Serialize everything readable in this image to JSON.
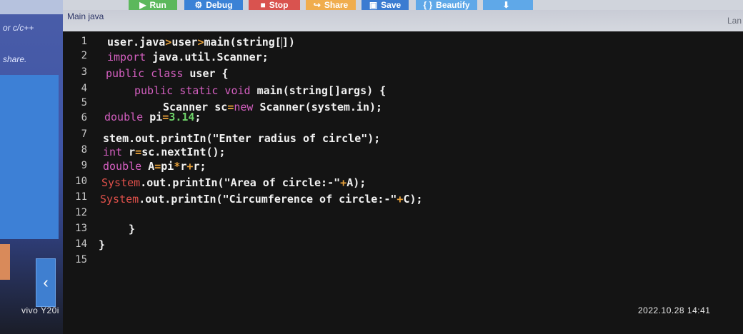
{
  "sidebar": {
    "items": [
      "or c/c++",
      "share."
    ],
    "back_icon": "chevron-left-icon"
  },
  "toolbar": {
    "buttons": [
      {
        "label": "Run",
        "icon": "play-icon",
        "color": "#5cb85c"
      },
      {
        "label": "Debug",
        "icon": "bug-icon",
        "color": "#3b82d6"
      },
      {
        "label": "Stop",
        "icon": "stop-icon",
        "color": "#d9534f"
      },
      {
        "label": "Share",
        "icon": "share-icon",
        "color": "#f0ad4e"
      },
      {
        "label": "Save",
        "icon": "save-icon",
        "color": "#3b7bd1"
      },
      {
        "label": "Beautify",
        "icon": "braces-icon",
        "color": "#5fa8e8"
      },
      {
        "label": "",
        "icon": "download-icon",
        "color": "#5fa8e8"
      }
    ]
  },
  "tab": {
    "label": "Main java"
  },
  "lang_label": "Lan",
  "editor": {
    "line_numbers": [
      "1",
      "2",
      "3",
      "4",
      "5",
      "6",
      "7",
      "8",
      "9",
      "10",
      "11",
      "12",
      "13",
      "14",
      "15"
    ]
  },
  "watermark": {
    "device": "vivo Y20i",
    "datetime": "2022.10.28 14:41"
  },
  "colors": {
    "keyword": "#d45fc0",
    "system": "#e0504a",
    "number": "#6fd36a",
    "operator": "#e9a23b"
  }
}
